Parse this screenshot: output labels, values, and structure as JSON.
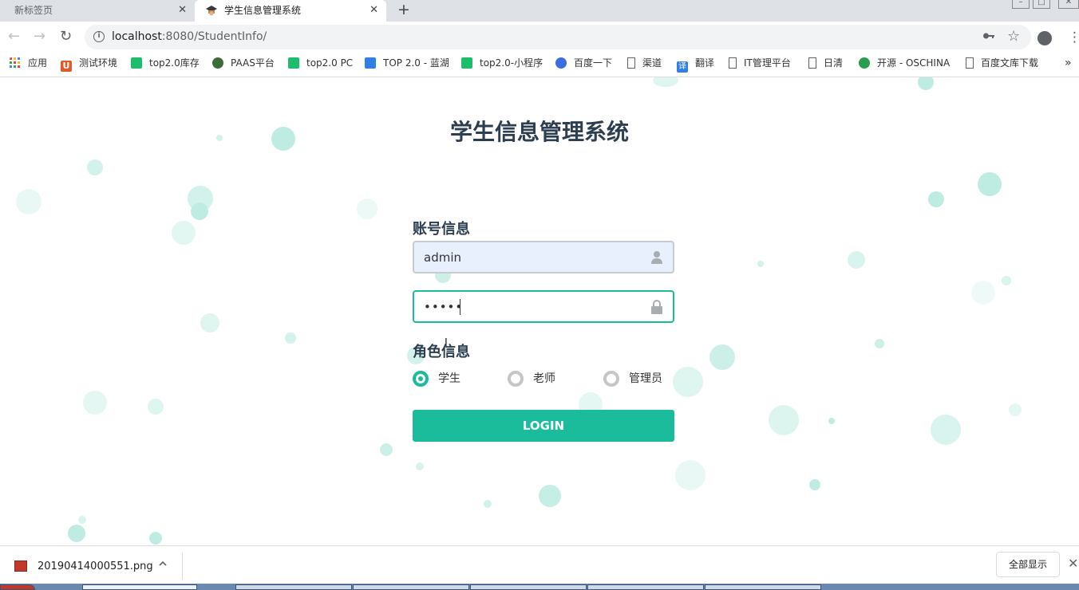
{
  "browser": {
    "tabs": [
      {
        "title": "新标签页",
        "close": "✕"
      },
      {
        "title": "学生信息管理系统",
        "close": "✕"
      }
    ],
    "new_tab": "+",
    "address": {
      "host": "localhost",
      "path": ":8080/StudentInfo/"
    },
    "nav": {
      "back": "←",
      "forward": "→",
      "reload": "↻"
    },
    "icons": {
      "key": "key-icon",
      "star": "☆",
      "menu": "⋮"
    },
    "bookmarks": [
      {
        "label": "应用",
        "icon": "apps-grid-icon",
        "color": "#e8453c"
      },
      {
        "label": "测试环境",
        "icon": "u-logo-icon",
        "color": "#e25a2b"
      },
      {
        "label": "top2.0库存",
        "icon": "green-play-icon",
        "color": "#1ebc6d"
      },
      {
        "label": "PAAS平台",
        "icon": "globe-icon",
        "color": "#3a6d3a"
      },
      {
        "label": "top2.0 PC",
        "icon": "green-play-icon",
        "color": "#1ebc6d"
      },
      {
        "label": "TOP 2.0 - 蓝湖",
        "icon": "lanhu-icon",
        "color": "#2f7fe6"
      },
      {
        "label": "top2.0-小程序",
        "icon": "green-play-icon",
        "color": "#1ebc6d"
      },
      {
        "label": "百度一下",
        "icon": "baidu-paw-icon",
        "color": "#3b6fe0"
      },
      {
        "label": "渠道",
        "icon": "page-icon",
        "color": "#ffffff"
      },
      {
        "label": "翻译",
        "icon": "translate-icon",
        "color": "#2f7fe6"
      },
      {
        "label": "IT管理平台",
        "icon": "page-icon",
        "color": "#ffffff"
      },
      {
        "label": "日清",
        "icon": "page-icon",
        "color": "#ffffff"
      },
      {
        "label": "开源 - OSCHINA",
        "icon": "oschina-icon",
        "color": "#2a9d4f"
      },
      {
        "label": "百度文库下载",
        "icon": "page-icon",
        "color": "#ffffff"
      }
    ],
    "bookmarks_more": "»"
  },
  "page": {
    "title": "学生信息管理系统",
    "account_label": "账号信息",
    "username": {
      "value": "admin",
      "icon": "user-icon"
    },
    "password": {
      "value": "•••••",
      "icon": "lock-icon"
    },
    "role_label": "角色信息",
    "roles": [
      {
        "label": "学生",
        "checked": true
      },
      {
        "label": "老师",
        "checked": false
      },
      {
        "label": "管理员",
        "checked": false
      }
    ],
    "login_label": "LOGIN",
    "accent_color": "#1abc9c"
  },
  "download_shelf": {
    "file_name": "20190414000551.png",
    "show_all": "全部显示",
    "close": "✕"
  }
}
